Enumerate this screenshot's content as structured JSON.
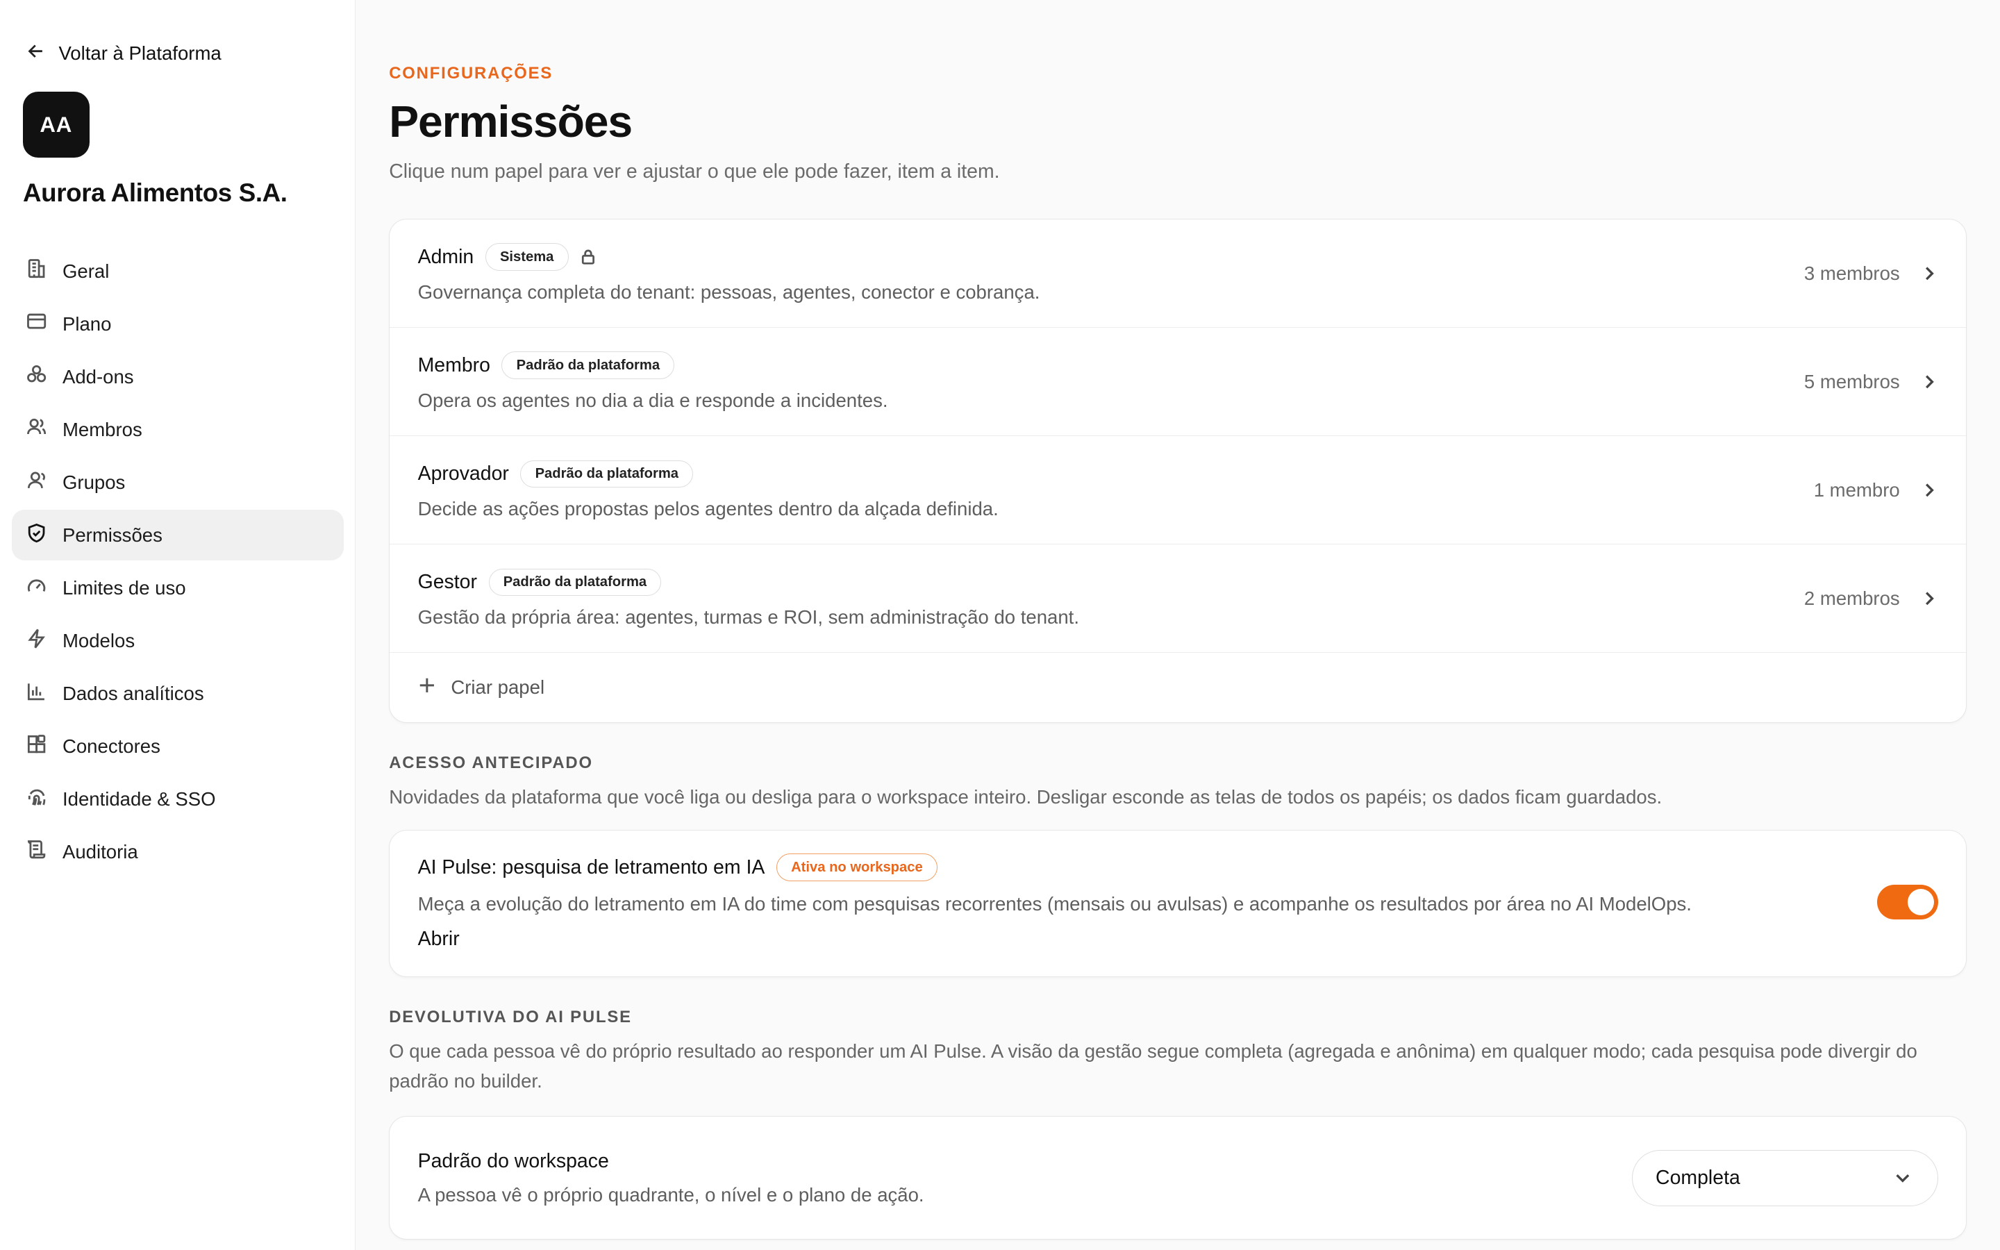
{
  "sidebar": {
    "back_label": "Voltar à Plataforma",
    "org_initials": "AA",
    "org_name": "Aurora Alimentos S.A.",
    "items": [
      {
        "label": "Geral",
        "icon": "building-icon"
      },
      {
        "label": "Plano",
        "icon": "credit-card-icon"
      },
      {
        "label": "Add-ons",
        "icon": "boxes-icon"
      },
      {
        "label": "Membros",
        "icon": "users-icon"
      },
      {
        "label": "Grupos",
        "icon": "user-group-icon"
      },
      {
        "label": "Permissões",
        "icon": "shield-check-icon",
        "active": true
      },
      {
        "label": "Limites de uso",
        "icon": "gauge-icon"
      },
      {
        "label": "Modelos",
        "icon": "bolt-icon"
      },
      {
        "label": "Dados analíticos",
        "icon": "bar-chart-icon"
      },
      {
        "label": "Conectores",
        "icon": "blocks-icon"
      },
      {
        "label": "Identidade & SSO",
        "icon": "fingerprint-icon"
      },
      {
        "label": "Auditoria",
        "icon": "scroll-icon"
      }
    ]
  },
  "header": {
    "eyebrow": "CONFIGURAÇÕES",
    "title": "Permissões",
    "subtitle": "Clique num papel para ver e ajustar o que ele pode fazer, item a item."
  },
  "roles": [
    {
      "name": "Admin",
      "badge": "Sistema",
      "locked": true,
      "description": "Governança completa do tenant: pessoas, agentes, conector e cobrança.",
      "members": "3 membros"
    },
    {
      "name": "Membro",
      "badge": "Padrão da plataforma",
      "locked": false,
      "description": "Opera os agentes no dia a dia e responde a incidentes.",
      "members": "5 membros"
    },
    {
      "name": "Aprovador",
      "badge": "Padrão da plataforma",
      "locked": false,
      "description": "Decide as ações propostas pelos agentes dentro da alçada definida.",
      "members": "1 membro"
    },
    {
      "name": "Gestor",
      "badge": "Padrão da plataforma",
      "locked": false,
      "description": "Gestão da própria área: agentes, turmas e ROI, sem administração do tenant.",
      "members": "2 membros"
    }
  ],
  "create_role_label": "Criar papel",
  "early_access": {
    "label": "ACESSO ANTECIPADO",
    "description": "Novidades da plataforma que você liga ou desliga para o workspace inteiro. Desligar esconde as telas de todos os papéis; os dados ficam guardados.",
    "feature": {
      "title": "AI Pulse: pesquisa de letramento em IA",
      "badge": "Ativa no workspace",
      "description": "Meça a evolução do letramento em IA do time com pesquisas recorrentes (mensais ou avulsas) e acompanhe os resultados por área no AI ModelOps.",
      "open_label": "Abrir",
      "enabled": true
    }
  },
  "feedback": {
    "label": "DEVOLUTIVA DO AI PULSE",
    "description": "O que cada pessoa vê do próprio resultado ao responder um AI Pulse. A visão da gestão segue completa (agregada e anônima) em qualquer modo; cada pesquisa pode divergir do padrão no builder.",
    "default_title": "Padrão do workspace",
    "default_description": "A pessoa vê o próprio quadrante, o nível e o plano de ação.",
    "select_value": "Completa"
  },
  "colors": {
    "accent": "#e8671c",
    "toggle_on": "#f06a12"
  }
}
